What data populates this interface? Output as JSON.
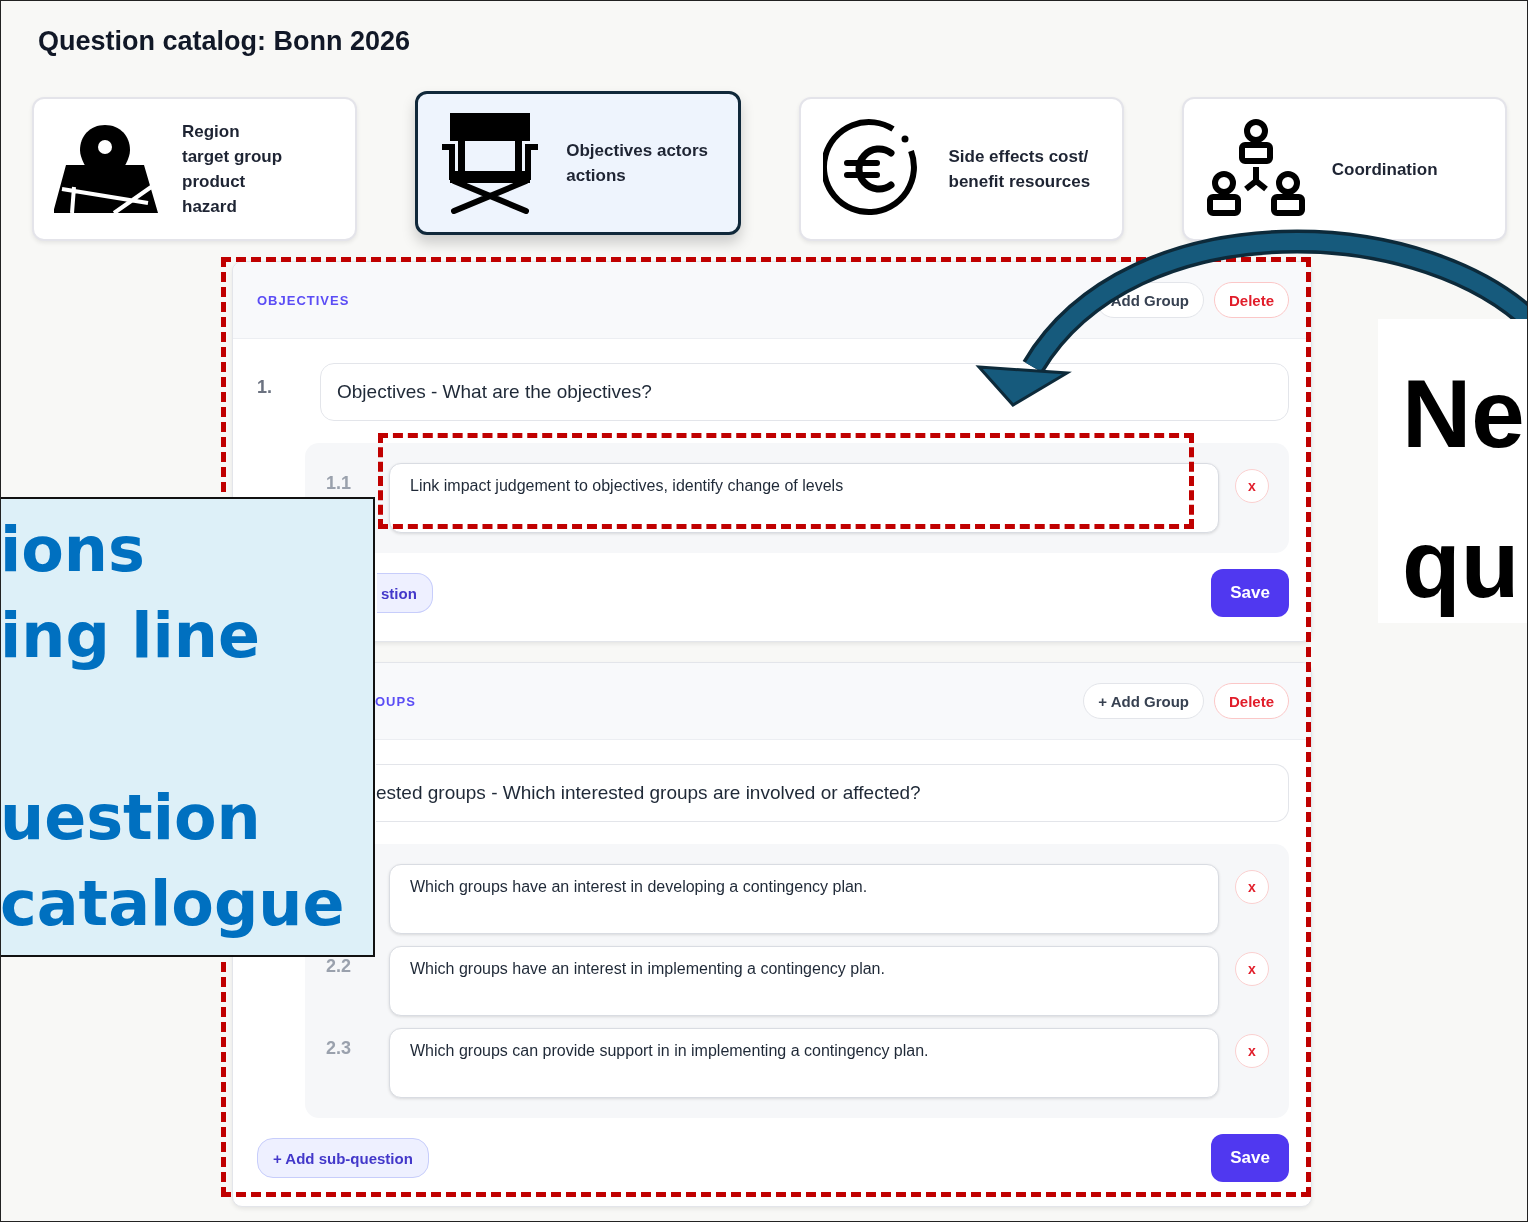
{
  "title": "Question catalog: Bonn 2026",
  "categories": [
    {
      "label": "Region\ntarget group\nproduct\nhazard",
      "selected": false
    },
    {
      "label": "Objectives actors\nactions",
      "selected": true
    },
    {
      "label": "Side effects cost/\nbenefit resources",
      "selected": false
    },
    {
      "label": "Coordination",
      "selected": false
    }
  ],
  "sections": [
    {
      "label": "OBJECTIVES",
      "add_group": "Add Group",
      "delete": "Delete",
      "number": "1.",
      "question": "Objectives - What are the objectives?",
      "subquestions": [
        {
          "number": "1.1",
          "text": "Link impact judgement to objectives, identify change of levels",
          "remove": "x"
        }
      ],
      "add_sub": "stion",
      "save": "Save"
    },
    {
      "label": "OUPS",
      "add_group": "+ Add Group",
      "delete": "Delete",
      "question": "ested groups - Which interested groups are involved or affected?",
      "subquestions": [
        {
          "text": "Which groups have an interest in developing a contingency plan.",
          "remove": "x"
        },
        {
          "number": "2.2",
          "text": "Which groups have an interest in implementing a contingency plan.",
          "remove": "x"
        },
        {
          "number": "2.3",
          "text": "Which groups can provide support in in implementing a contingency plan.",
          "remove": "x"
        }
      ],
      "add_sub": "+ Add sub-question",
      "save": "Save"
    }
  ],
  "callout_left": {
    "lines": [
      "ions",
      "ing line",
      "uestion",
      "catalogue"
    ]
  },
  "callout_right": {
    "lines": [
      "Ne",
      "qu"
    ]
  }
}
